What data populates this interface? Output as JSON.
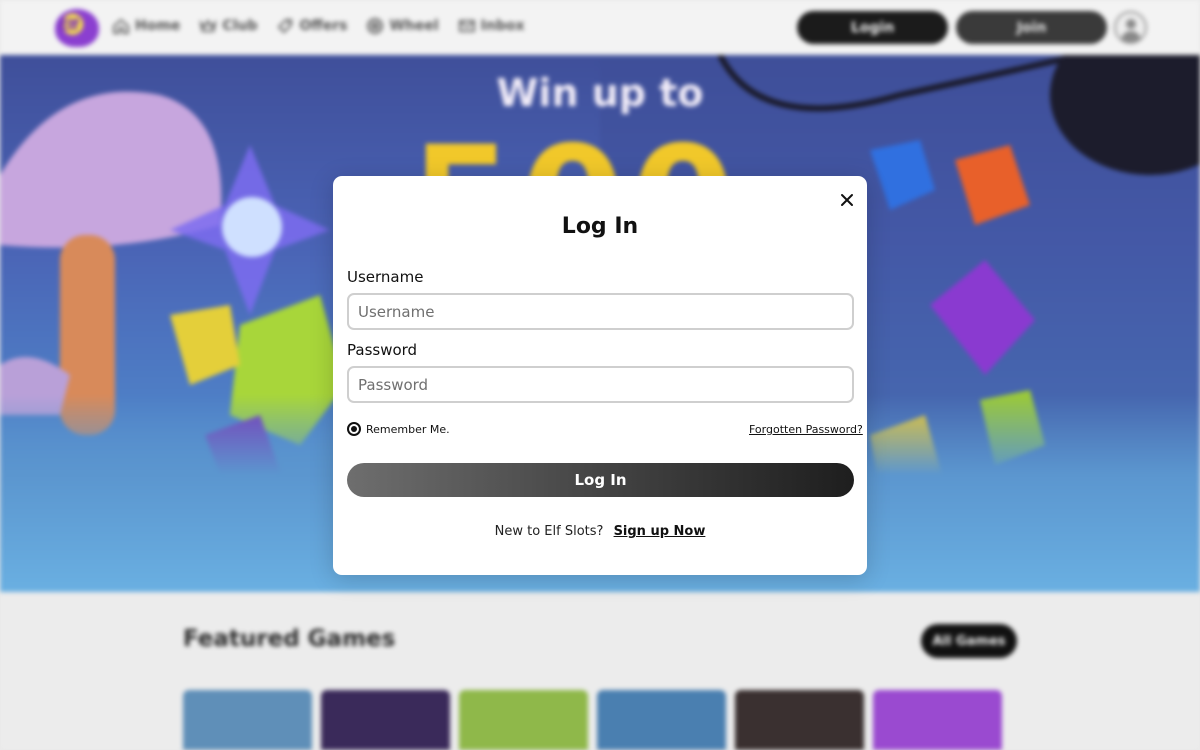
{
  "topbar": {
    "logo_text": "Elf",
    "nav": [
      {
        "label": "Home",
        "icon": "home-icon"
      },
      {
        "label": "Club",
        "icon": "crown-icon"
      },
      {
        "label": "Offers",
        "icon": "tag-icon"
      },
      {
        "label": "Wheel",
        "icon": "wheel-icon"
      },
      {
        "label": "Inbox",
        "icon": "mail-icon"
      }
    ],
    "login_label": "Login",
    "join_label": "Join"
  },
  "hero": {
    "headline": "Win up to",
    "amount": "500"
  },
  "featured": {
    "title": "Featured Games",
    "all_games_label": "All Games",
    "tile_colors": [
      "#5f8fb8",
      "#3a2a5a",
      "#8fb84a",
      "#4a7fb0",
      "#3a3030",
      "#9a4ad0"
    ]
  },
  "modal": {
    "title": "Log In",
    "username_label": "Username",
    "username_placeholder": "Username",
    "password_label": "Password",
    "password_placeholder": "Password",
    "remember_label": "Remember Me.",
    "forgot_label": "Forgotten Password?",
    "submit_label": "Log In",
    "new_prompt": "New to Elf Slots?",
    "signup_label": "Sign up Now"
  },
  "colors": {
    "accent_dark": "#1b1b1b",
    "hero_gold": "#f1c82a"
  }
}
